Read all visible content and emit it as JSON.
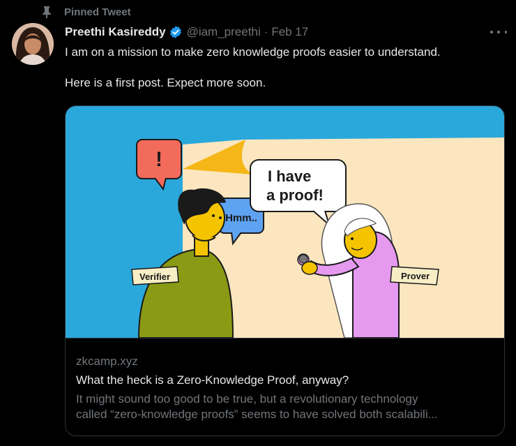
{
  "pin": {
    "label": "Pinned Tweet",
    "icon": "pin-icon"
  },
  "author": {
    "name": "Preethi Kasireddy",
    "handle": "@iam_preethi",
    "separator": "·",
    "date": "Feb 17",
    "verified_color": "#1d9bf0"
  },
  "tweet": {
    "line1": "I am on a mission to make zero knowledge proofs easier to understand.",
    "line2": "Here is a first post. Expect more soon."
  },
  "card": {
    "illustration": {
      "bubble_alert": "!",
      "bubble_hmm": "Hmm..",
      "bubble_proof_line1": "I have",
      "bubble_proof_line2": "a proof!",
      "tag_verifier": "Verifier",
      "tag_prover": "Prover",
      "bg_color": "#2aa8dc"
    },
    "domain": "zkcamp.xyz",
    "title": "What the heck is a Zero-Knowledge Proof, anyway?",
    "desc_line1": "It might sound too good to be true, but a revolutionary technology",
    "desc_line2": "called “zero-knowledge proofs” seems to have solved both scalabili..."
  },
  "more_icon": "more-dots-icon"
}
